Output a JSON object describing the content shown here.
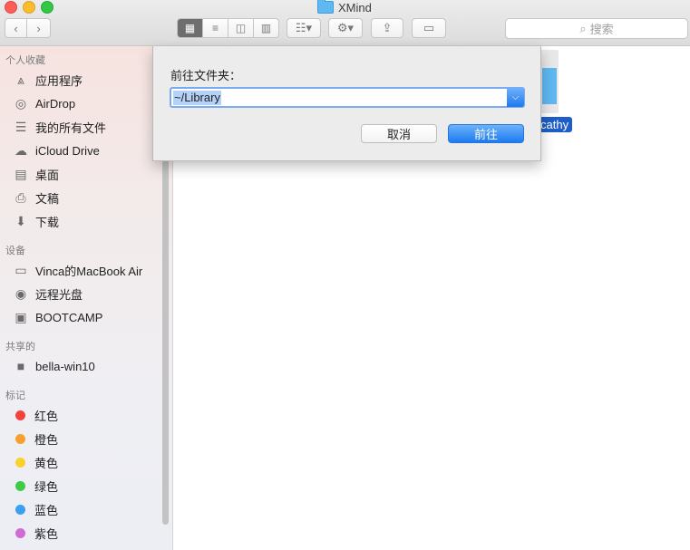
{
  "window": {
    "title": "XMind"
  },
  "toolbar": {
    "back_icon": "chevron-left-icon",
    "forward_icon": "chevron-right-icon",
    "view_modes": [
      "icon-view",
      "list-view",
      "column-view",
      "cover-flow-view"
    ],
    "active_view": "icon-view",
    "search_placeholder": "搜索"
  },
  "sidebar": {
    "sections": [
      {
        "title": "个人收藏",
        "items": [
          {
            "label": "应用程序",
            "icon": "applications-icon"
          },
          {
            "label": "AirDrop",
            "icon": "airdrop-icon"
          },
          {
            "label": "我的所有文件",
            "icon": "all-files-icon"
          },
          {
            "label": "iCloud Drive",
            "icon": "cloud-icon"
          },
          {
            "label": "桌面",
            "icon": "desktop-icon"
          },
          {
            "label": "文稿",
            "icon": "documents-icon"
          },
          {
            "label": "下载",
            "icon": "download-icon"
          }
        ]
      },
      {
        "title": "设备",
        "items": [
          {
            "label": "Vinca的MacBook Air",
            "icon": "laptop-icon"
          },
          {
            "label": "远程光盘",
            "icon": "disc-icon"
          },
          {
            "label": "BOOTCAMP",
            "icon": "drive-icon"
          }
        ]
      },
      {
        "title": "共享的",
        "items": [
          {
            "label": "bella-win10",
            "icon": "monitor-icon"
          }
        ]
      },
      {
        "title": "标记",
        "items": [
          {
            "label": "红色",
            "color": "#f2423a"
          },
          {
            "label": "橙色",
            "color": "#f7a02c"
          },
          {
            "label": "黄色",
            "color": "#f9d12e"
          },
          {
            "label": "绿色",
            "color": "#3dcb48"
          },
          {
            "label": "蓝色",
            "color": "#3aa0f3"
          },
          {
            "label": "紫色",
            "color": "#d26ad6"
          }
        ]
      }
    ]
  },
  "content": {
    "folder_name": "cathy"
  },
  "dialog": {
    "label": "前往文件夹：",
    "path_value": "~/Library",
    "cancel_label": "取消",
    "go_label": "前往"
  },
  "colors": {
    "accent": "#1f7aef",
    "selection": "#1f5ec8"
  }
}
